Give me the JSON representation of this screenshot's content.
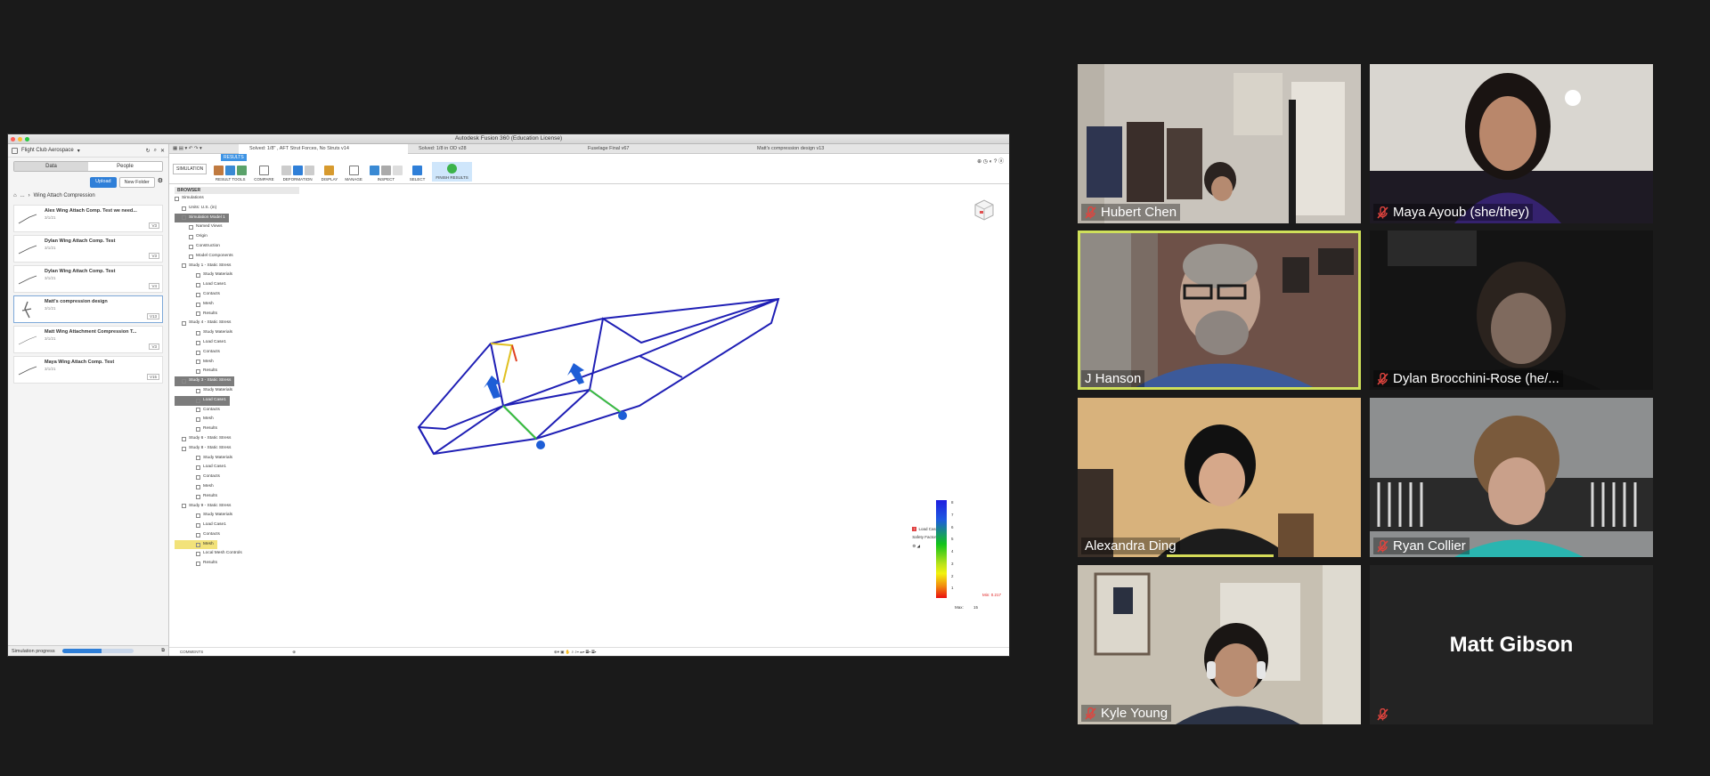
{
  "app": {
    "window_title": "Autodesk Fusion 360 (Education License)",
    "project": "Flight Club Aerospace"
  },
  "data_panel": {
    "tabs": [
      "Data",
      "People"
    ],
    "active_tab": "Data",
    "upload_label": "Upload",
    "new_folder_label": "New Folder",
    "breadcrumb_more": "...",
    "breadcrumb": "Wing Attach Compression",
    "items": [
      {
        "name": "Alex Wing Attach Comp. Test we need...",
        "date": "3/1/21",
        "version": "V3"
      },
      {
        "name": "Dylan Wing Attach Comp. Test",
        "date": "3/1/21",
        "version": "V3"
      },
      {
        "name": "Dylan Wing Attach Comp. Test",
        "date": "3/1/21",
        "version": "V4"
      },
      {
        "name": "Matt's compression design",
        "date": "3/1/21",
        "version": "V13"
      },
      {
        "name": "Matt Wing Attachment Compression T...",
        "date": "3/1/21",
        "version": "V3"
      },
      {
        "name": "Maya Wing Attach Comp. Test",
        "date": "3/1/21",
        "version": "V15"
      }
    ],
    "status_label": "Simulation progress",
    "progress": 0.55
  },
  "doc_tabs": [
    "Solved: 1/8\" , AFT Strut Forces, No Struts v14",
    "Solved: 1/8 in OD v28",
    "Fuselage Final v67",
    "Matt's compression design v13"
  ],
  "toolbar": {
    "workspace": "SIMULATION",
    "results_tab": "RESULTS",
    "groups": [
      "RESULT TOOLS",
      "COMPARE",
      "DEFORMATION",
      "DISPLAY",
      "MANAGE",
      "INSPECT",
      "SELECT",
      "FINISH RESULTS"
    ]
  },
  "browser": {
    "header": "BROWSER",
    "rows": [
      {
        "label": "Simulations",
        "style": ""
      },
      {
        "label": "Units: U.S. (in)",
        "style": ""
      },
      {
        "label": "Simulation Model 1",
        "style": "hl"
      },
      {
        "label": "Named Views",
        "style": ""
      },
      {
        "label": "Origin",
        "style": ""
      },
      {
        "label": "Construction",
        "style": ""
      },
      {
        "label": "Model Components",
        "style": ""
      },
      {
        "label": "Study 1 - Static Stress",
        "style": ""
      },
      {
        "label": "Study Materials",
        "style": ""
      },
      {
        "label": "Load Case1",
        "style": ""
      },
      {
        "label": "Contacts",
        "style": ""
      },
      {
        "label": "Mesh",
        "style": ""
      },
      {
        "label": "Results",
        "style": ""
      },
      {
        "label": "Study 4 - Static Stress",
        "style": ""
      },
      {
        "label": "Study Materials",
        "style": ""
      },
      {
        "label": "Load Case1",
        "style": ""
      },
      {
        "label": "Contacts",
        "style": ""
      },
      {
        "label": "Mesh",
        "style": ""
      },
      {
        "label": "Results",
        "style": ""
      },
      {
        "label": "Study 3 - Static Stress",
        "style": "hl"
      },
      {
        "label": "Study Materials",
        "style": ""
      },
      {
        "label": "Load Case1",
        "style": "hl"
      },
      {
        "label": "Contacts",
        "style": ""
      },
      {
        "label": "Mesh",
        "style": ""
      },
      {
        "label": "Results",
        "style": ""
      },
      {
        "label": "Study 6 - Static Stress",
        "style": ""
      },
      {
        "label": "Study 8 - Static Stress",
        "style": ""
      },
      {
        "label": "Study Materials",
        "style": ""
      },
      {
        "label": "Load Case1",
        "style": ""
      },
      {
        "label": "Contacts",
        "style": ""
      },
      {
        "label": "Mesh",
        "style": ""
      },
      {
        "label": "Results",
        "style": ""
      },
      {
        "label": "Study 9 - Static Stress",
        "style": ""
      },
      {
        "label": "Study Materials",
        "style": ""
      },
      {
        "label": "Load Case1",
        "style": ""
      },
      {
        "label": "Contacts",
        "style": ""
      },
      {
        "label": "Mesh",
        "style": "yl"
      },
      {
        "label": "Local Mesh Controls",
        "style": ""
      },
      {
        "label": "Results",
        "style": ""
      }
    ]
  },
  "legend": {
    "load_case": "Load Case1",
    "metric": "Safety Factor",
    "ticks": [
      "8",
      "7",
      "6",
      "5",
      "4",
      "3",
      "2",
      "1"
    ],
    "max_label": "Max:",
    "max_value": "15",
    "min_label": "Min: 0.217"
  },
  "comments_label": "COMMENTS",
  "participants": [
    {
      "name": "Hubert Chen",
      "muted": true
    },
    {
      "name": "Maya Ayoub (she/they)",
      "muted": true
    },
    {
      "name": "J Hanson",
      "muted": false,
      "speaking": true
    },
    {
      "name": "Dylan Brocchini-Rose (he/...",
      "muted": true
    },
    {
      "name": "Alexandra Ding",
      "muted": false
    },
    {
      "name": "Ryan Collier",
      "muted": true
    },
    {
      "name": "Kyle Young",
      "muted": true
    },
    {
      "name": "Matt Gibson",
      "muted": true,
      "video_off": true
    }
  ],
  "colors": {
    "speaker_border": "#cfe05a",
    "mute_icon": "#e0443e",
    "accent": "#2f7fd8"
  }
}
